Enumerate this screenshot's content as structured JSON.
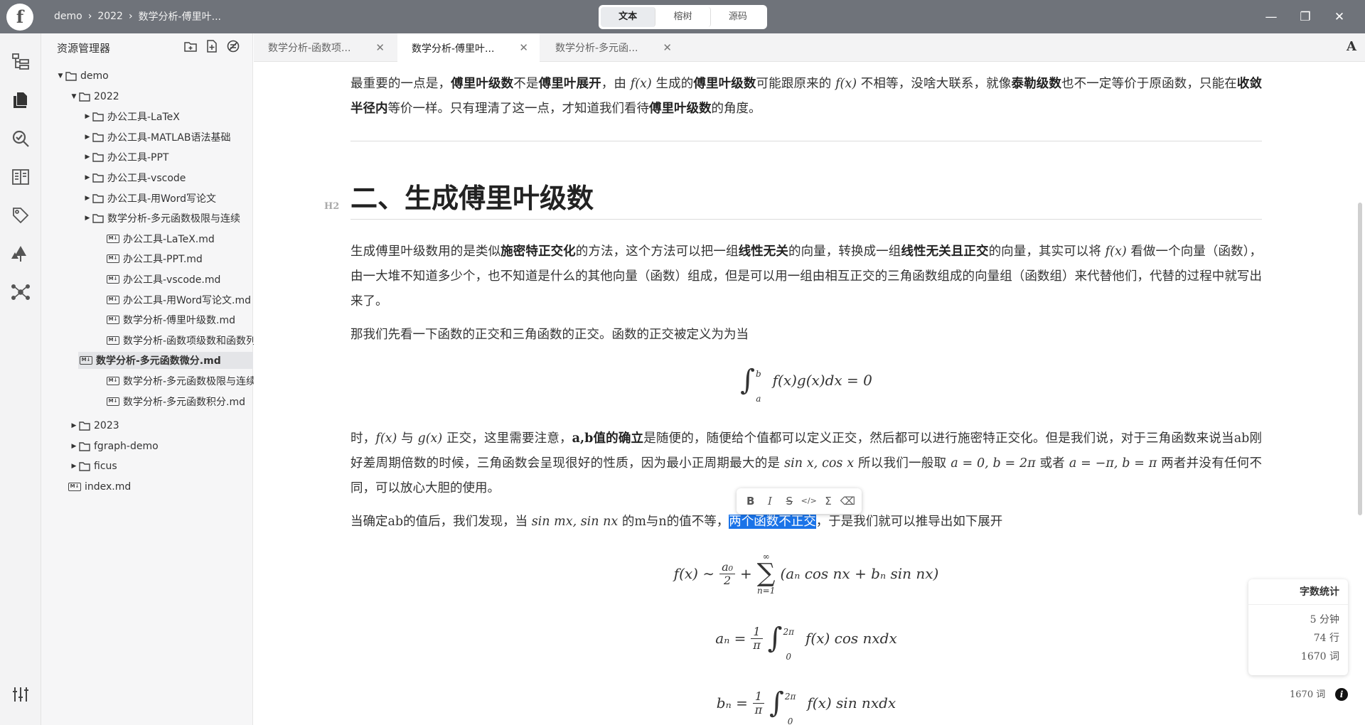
{
  "titlebar": {
    "logo": "f",
    "crumbs": [
      "demo",
      "2022",
      "数学分析-傅里叶..."
    ],
    "modes": [
      "文本",
      "榕树",
      "源码"
    ],
    "active_mode": "文本"
  },
  "sidebar": {
    "title": "资源管理器",
    "tree": [
      {
        "label": "demo",
        "type": "folder",
        "open": true,
        "depth": 0
      },
      {
        "label": "2022",
        "type": "folder",
        "open": true,
        "depth": 1
      },
      {
        "label": "办公工具-LaTeX",
        "type": "folder",
        "open": false,
        "depth": 2
      },
      {
        "label": "办公工具-MATLAB语法基础",
        "type": "folder",
        "open": false,
        "depth": 2
      },
      {
        "label": "办公工具-PPT",
        "type": "folder",
        "open": false,
        "depth": 2
      },
      {
        "label": "办公工具-vscode",
        "type": "folder",
        "open": false,
        "depth": 2
      },
      {
        "label": "办公工具-用Word写论文",
        "type": "folder",
        "open": false,
        "depth": 2
      },
      {
        "label": "数学分析-多元函数极限与连续",
        "type": "folder",
        "open": false,
        "depth": 2
      },
      {
        "label": "办公工具-LaTeX.md",
        "type": "file",
        "depth": 2
      },
      {
        "label": "办公工具-PPT.md",
        "type": "file",
        "depth": 2
      },
      {
        "label": "办公工具-vscode.md",
        "type": "file",
        "depth": 2
      },
      {
        "label": "办公工具-用Word写论文.md",
        "type": "file",
        "depth": 2
      },
      {
        "label": "数学分析-傅里叶级数.md",
        "type": "file",
        "depth": 2
      },
      {
        "label": "数学分析-函数项级数和函数列.md",
        "type": "file",
        "depth": 2
      },
      {
        "label": "数学分析-多元函数微分.md",
        "type": "file",
        "depth": 2,
        "active": true
      },
      {
        "label": "数学分析-多元函数极限与连续.md",
        "type": "file",
        "depth": 2
      },
      {
        "label": "数学分析-多元函数积分.md",
        "type": "file",
        "depth": 2
      },
      {
        "label": "2023",
        "type": "folder",
        "open": false,
        "depth": 1
      },
      {
        "label": "fgraph-demo",
        "type": "folder",
        "open": false,
        "depth": 1
      },
      {
        "label": "ficus",
        "type": "folder",
        "open": false,
        "depth": 1
      },
      {
        "label": "index.md",
        "type": "file",
        "depth": 0
      }
    ]
  },
  "tabs": [
    {
      "label": "数学分析-函数项...",
      "active": false
    },
    {
      "label": "数学分析-傅里叶...",
      "active": true
    },
    {
      "label": "数学分析-多元函...",
      "active": false
    }
  ],
  "font_button": "A",
  "doc": {
    "p1": {
      "t1": "最重要的一点是，",
      "b1": "傅里叶级数",
      "t2": "不是",
      "b2": "傅里叶展开",
      "t3": "，由 ",
      "f": "f(x)",
      "t4": " 生成的",
      "b3": "傅里叶级数",
      "t5": "可能跟原来的 ",
      "f2": "f(x)",
      "t6": " 不相等，没啥大联系，就像",
      "b4": "泰勒级数",
      "t7": "也不一定等价于原函数，只能在",
      "b5": "收敛半径内",
      "t8": "等价一样。只有理清了这一点，才知道我们看待",
      "b6": "傅里叶级数",
      "t9": "的角度。"
    },
    "h2_marker": "H2",
    "h2": "二、生成傅里叶级数",
    "p2": {
      "t1": "生成傅里叶级数用的是类似",
      "b1": "施密特正交化",
      "t2": "的方法，这个方法可以把一组",
      "b2": "线性无关",
      "t3": "的向量，转换成一组",
      "b3": "线性无关且正交",
      "t4": "的向量，其实可以将 ",
      "f": "f(x)",
      "t5": " 看做一个向量（函数），由一大堆不知道多少个，也不知道是什么的其他向量（函数）组成，但是可以用一组由相互正交的三角函数组成的向量组（函数组）来代替他们，代替的过程中就写出来了。"
    },
    "p3": "那我们先看一下函数的正交和三角函数的正交。函数的正交被定义为为当",
    "eq1": {
      "upper": "b",
      "lower": "a",
      "body": "f(x)g(x)dx = 0"
    },
    "p4": {
      "t1": "时，",
      "f": "f(x)",
      "t2": " 与 ",
      "g": "g(x)",
      "t3": " 正交，这里需要注意，",
      "b1": "a,b值的确立",
      "t4": "是随便的，随便给个值都可以定义正交，然后都可以进行施密特正交化。但是我们说，对于三角函数来说当ab刚好差周期倍数的时候，三角函数会呈现很好的性质，因为最小正周期最大的是 ",
      "trig": "sin x, cos x",
      "t5": " 所以我们一般取 ",
      "c1": "a = 0, b = 2π",
      "t6": " 或者 ",
      "c2": "a = −π, b = π",
      "t7": " 两者并没有任何不同，可以放心大胆的使用。"
    },
    "p5": {
      "t1": "当确定ab的值后，我们发现，当 ",
      "trig": "sin mx, sin nx",
      "t2": " 的m与n的值不等，",
      "hl": "两个函数不正交",
      "t3": "，于是我们就可以推导出如下展开"
    },
    "eq2": {
      "lhs": "f(x) ∼",
      "num": "a₀",
      "den": "2",
      "plus": "+",
      "sup": "∞",
      "sub": "n=1",
      "body": "(aₙ cos nx + bₙ sin nx)"
    },
    "eq3": {
      "lhs": "aₙ =",
      "num": "1",
      "den": "π",
      "upper": "2π",
      "lower": "0",
      "body": "f(x) cos nxdx"
    },
    "eq4": {
      "lhs": "bₙ =",
      "num": "1",
      "den": "π",
      "upper": "2π",
      "lower": "0",
      "body": "f(x) sin nxdx"
    }
  },
  "format_toolbar": [
    "B",
    "I",
    "S",
    "</>",
    "Σ",
    "⌫"
  ],
  "word_count": {
    "title": "字数统计",
    "minutes": "5 分钟",
    "lines": "74 行",
    "words": "1670 词"
  },
  "status": {
    "words": "1670 词",
    "info": "i"
  },
  "colors": {
    "titlebar": "#6f737a",
    "highlight": "#1a73e8"
  }
}
